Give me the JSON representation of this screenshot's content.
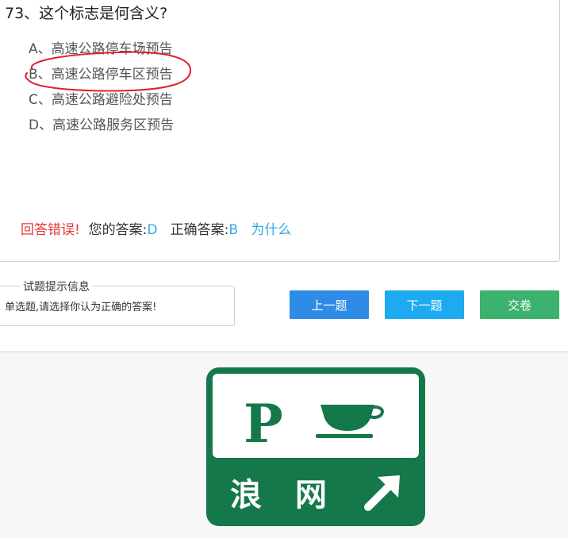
{
  "question": {
    "title": "73、这个标志是何含义?",
    "options": [
      {
        "letter": "A",
        "text": "A、高速公路停车场预告"
      },
      {
        "letter": "B",
        "text": "B、高速公路停车区预告"
      },
      {
        "letter": "C",
        "text": "C、高速公路避险处预告"
      },
      {
        "letter": "D",
        "text": "D、高速公路服务区预告"
      }
    ]
  },
  "result": {
    "status": "回答错误!",
    "your_answer_label": "您的答案:",
    "your_answer": "D",
    "correct_label": "正确答案:",
    "correct_answer": "B",
    "why_link": "为什么"
  },
  "hint": {
    "legend": "试题提示信息",
    "text": "单选题,请选择你认为正确的答案!"
  },
  "buttons": {
    "prev": "上一题",
    "next": "下一题",
    "submit": "交卷"
  },
  "colors": {
    "prev_button": "#2f8ce6",
    "next_button": "#1eaaf1",
    "submit_button": "#3bb26e",
    "error_text": "#e53935",
    "answer_text": "#2fa9e8",
    "sign_green": "#14784a",
    "annotation_red": "#e0202a"
  },
  "sign": {
    "parking_letter": "P",
    "text_left": "浪",
    "text_right": "网",
    "icons": [
      "parking-icon",
      "coffee-cup-icon",
      "arrow-up-right-icon"
    ]
  }
}
